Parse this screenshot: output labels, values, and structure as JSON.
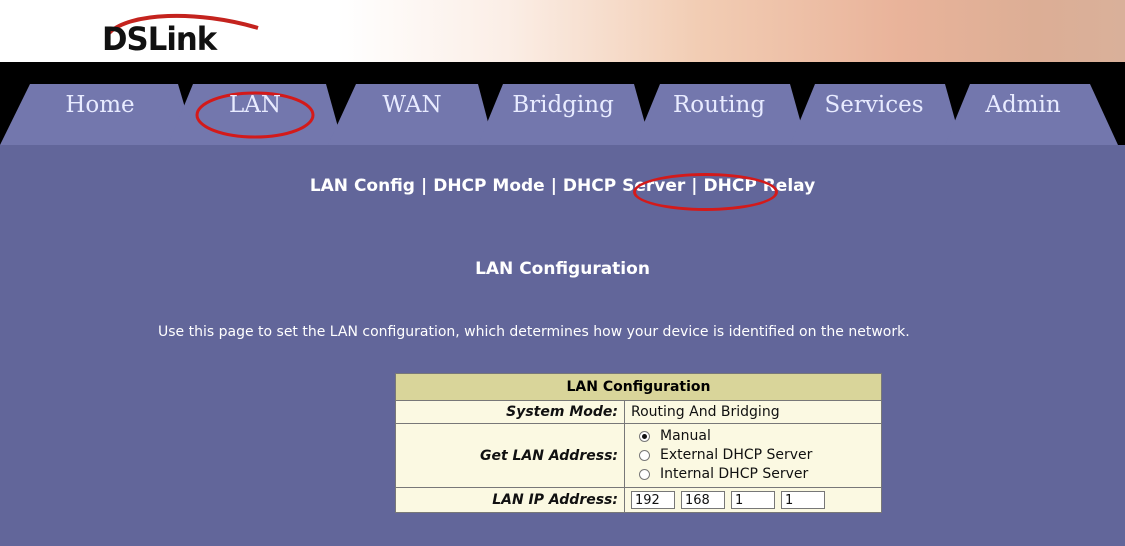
{
  "logo": {
    "text": "DSLink"
  },
  "nav": {
    "tabs": [
      {
        "label": "Home"
      },
      {
        "label": "LAN"
      },
      {
        "label": "WAN"
      },
      {
        "label": "Bridging"
      },
      {
        "label": "Routing"
      },
      {
        "label": "Services"
      },
      {
        "label": "Admin"
      }
    ],
    "active_tab": "LAN",
    "highlight_color": "#d31a1a"
  },
  "subnav": {
    "links": [
      "LAN Config",
      "DHCP Mode",
      "DHCP Server",
      "DHCP Relay"
    ],
    "separator": "|",
    "highlighted": "DHCP Server"
  },
  "page": {
    "title": "LAN Configuration",
    "description": "Use this page to set the LAN configuration, which determines how your device is identified on the network."
  },
  "table": {
    "header": "LAN Configuration",
    "system_mode_label": "System Mode:",
    "system_mode_value": "Routing And Bridging",
    "get_lan_label": "Get LAN Address:",
    "get_lan_options": [
      "Manual",
      "External DHCP Server",
      "Internal DHCP Server"
    ],
    "get_lan_selected": "Manual",
    "lan_ip_label": "LAN IP Address:",
    "lan_ip_values": [
      "192",
      "168",
      "1",
      "1"
    ]
  },
  "colors": {
    "background": "#62669a",
    "tab_fill": "#7377ad",
    "tab_bar": "#000000",
    "table_header": "#d9d59a",
    "table_body": "#fbf9e2"
  }
}
